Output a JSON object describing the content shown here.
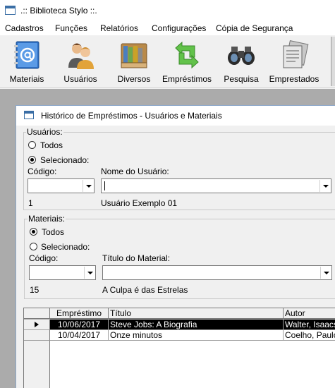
{
  "window": {
    "title": ".:: Biblioteca Stylo ::."
  },
  "menu": [
    "Cadastros",
    "Funções",
    "Relatórios",
    "Configurações",
    "Cópia de Segurança"
  ],
  "toolbar": [
    {
      "label": "Materiais",
      "icon": "address-book-icon"
    },
    {
      "label": "Usuários",
      "icon": "users-icon"
    },
    {
      "label": "Diversos",
      "icon": "books-icon"
    },
    {
      "label": "Empréstimos",
      "icon": "exchange-arrows-icon"
    },
    {
      "label": "Pesquisa",
      "icon": "binoculars-icon"
    },
    {
      "label": "Emprestados",
      "icon": "documents-icon"
    }
  ],
  "form": {
    "title": "Histórico de Empréstimos - Usuários e Materiais",
    "usuarios": {
      "group_label": "Usuários:",
      "option_all": "Todos",
      "option_selected": "Selecionado:",
      "selected_option": "Selecionado:",
      "code_label": "Código:",
      "name_label": "Nome do Usuário:",
      "code_value": "",
      "name_value": "",
      "code_display": "1",
      "name_display": "Usuário Exemplo 01"
    },
    "materiais": {
      "group_label": "Materiais:",
      "option_all": "Todos",
      "option_selected": "Selecionado:",
      "selected_option": "Todos",
      "code_label": "Código:",
      "title_label": "Título do Material:",
      "code_value": "",
      "title_value": "",
      "code_display": "15",
      "title_display": "A Culpa é das Estrelas"
    }
  },
  "grid": {
    "columns": [
      "Empréstimo",
      "Título",
      "Autor"
    ],
    "rows": [
      {
        "emprestimo": "10/06/2017",
        "titulo": "Steve Jobs: A Biografia",
        "autor": "Walter, Isaacson",
        "selected": true
      },
      {
        "emprestimo": "10/04/2017",
        "titulo": "Onze minutos",
        "autor": "Coelho, Paulo",
        "selected": false
      }
    ]
  },
  "colors": {
    "mdi_background": "#ababab",
    "selection": "#000000",
    "window_bg": "#f0f0f0"
  }
}
